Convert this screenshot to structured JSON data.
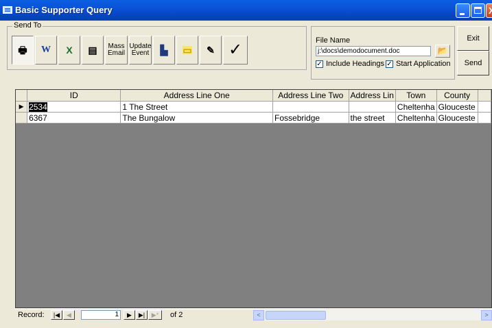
{
  "window": {
    "title": "Basic Supporter Query",
    "minimize_label": "",
    "maximize_label": "",
    "close_label": "X"
  },
  "send_to": {
    "label": "Send To",
    "buttons": [
      {
        "name": "printer",
        "label": "🖶",
        "icon": "printer-icon"
      },
      {
        "name": "word",
        "label": "W",
        "icon": "word-icon"
      },
      {
        "name": "excel",
        "label": "X",
        "icon": "excel-icon"
      },
      {
        "name": "contact-card",
        "label": "▤",
        "icon": "contact-card-icon"
      },
      {
        "name": "mass-email",
        "label": "Mass Email"
      },
      {
        "name": "update-event",
        "label": "Update Event"
      },
      {
        "name": "chart",
        "label": "▙",
        "icon": "chart-icon"
      },
      {
        "name": "label",
        "label": "▭",
        "icon": "label-icon"
      },
      {
        "name": "edit-form",
        "label": "✎",
        "icon": "edit-form-icon"
      },
      {
        "name": "checkmark",
        "label": "✓",
        "icon": "checkmark-icon"
      }
    ]
  },
  "file": {
    "label": "File Name",
    "value": "j:\\docs\\demodocument.doc",
    "include_headings_label": "Include Headings",
    "include_headings_checked": true,
    "start_application_label": "Start Application",
    "start_application_checked": true,
    "folder_icon": "folder-icon"
  },
  "actions": {
    "exit_label": "Exit",
    "send_label": "Send"
  },
  "grid": {
    "columns": [
      "ID",
      "Address Line One",
      "Address Line Two",
      "Address Lin",
      "Town",
      "County"
    ],
    "rows": [
      {
        "selector": "▶",
        "cells": [
          "2534",
          "1 The Street",
          "",
          "",
          "Cheltenha",
          "Glouceste"
        ]
      },
      {
        "selector": "",
        "cells": [
          "6367",
          "The Bungalow",
          "Fossebridge",
          "the street",
          "Cheltenha",
          "Glouceste"
        ]
      }
    ]
  },
  "navigation": {
    "record_label": "Record:",
    "current_record": "1",
    "of_label": "of 2",
    "first_glyph": "|◀",
    "prev_glyph": "◀",
    "next_glyph": "▶",
    "last_glyph": "▶|",
    "new_glyph": "▶*"
  },
  "colors": {
    "titlebar": "#0b52d6",
    "form_bg": "#ece9d8",
    "grid_bg": "#808080"
  }
}
